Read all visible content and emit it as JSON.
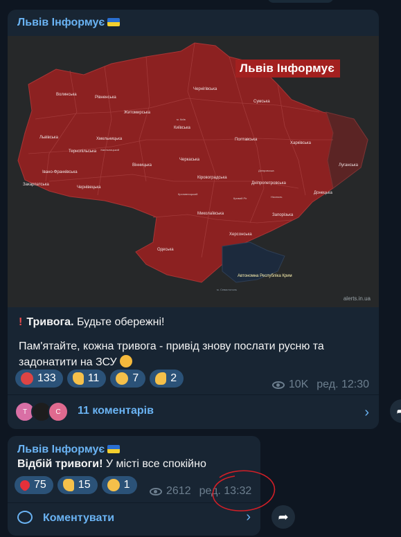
{
  "post1": {
    "channel_name": "Львів Інформує",
    "flag": "ukraine-flag",
    "map": {
      "brand": "Львів Інформує",
      "attribution": "alerts.in.ua",
      "alert_color": "#8c2121",
      "regions": [
        "Волинська",
        "Рівненська",
        "Житомирська",
        "Чернігівська",
        "Сумська",
        "Київська",
        "Львівська",
        "Хмельницька",
        "Тернопільська",
        "Полтавська",
        "Харківська",
        "Черкаська",
        "Вінницька",
        "Івано-Франківська",
        "Луганська",
        "Закарпатська",
        "Чернівецька",
        "Кіровоградська",
        "Дніпропетровська",
        "Донецька",
        "Миколаївська",
        "Запорізька",
        "Херсонська",
        "Одеська",
        "Автономна Республіка Крим"
      ],
      "city_labels": [
        "м. Київ",
        "Хмельницький",
        "м. Севастополь",
        "Кривий Ріг",
        "Нікополь",
        "Дніпровська",
        "Кропивницький"
      ]
    },
    "text": {
      "alert_label": "Тривога.",
      "alert_text": "Будьте обережні!",
      "line2": "Пам'ятайте, кожна тривога - привід знову послати русню та задонатити на ЗСУ"
    },
    "reactions": [
      {
        "icon": "angry-face-icon",
        "count": "133"
      },
      {
        "icon": "thumbs-up-icon",
        "count": "11"
      },
      {
        "icon": "crying-face-icon",
        "count": "7"
      },
      {
        "icon": "thumbs-down-icon",
        "count": "2"
      }
    ],
    "views": "10K",
    "time": "ред. 12:30",
    "comments": {
      "label": "11 коментарів",
      "avatars": [
        "Т",
        "",
        "С"
      ]
    }
  },
  "post2": {
    "channel_name": "Львів Інформує",
    "text_bold": "Відбій тривоги!",
    "text_rest": "У місті все спокійно",
    "reactions": [
      {
        "icon": "heart-icon",
        "count": "75"
      },
      {
        "icon": "thumbs-up-icon",
        "count": "15"
      },
      {
        "icon": "heart-eyes-icon",
        "count": "1"
      }
    ],
    "views": "2612",
    "time": "ред. 13:32",
    "comment_label": "Коментувати"
  }
}
